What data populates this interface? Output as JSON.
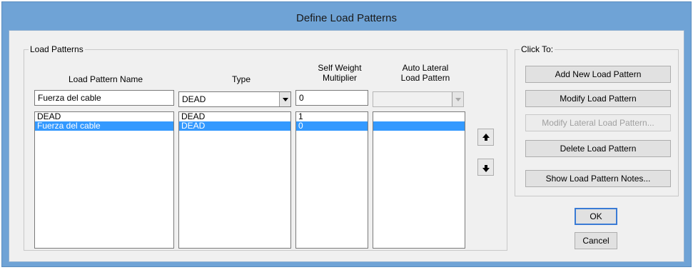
{
  "window": {
    "title": "Define Load Patterns"
  },
  "load_patterns": {
    "group_label": "Load Patterns",
    "headers": {
      "name": "Load Pattern Name",
      "type": "Type",
      "self_weight": [
        "Self Weight",
        "Multiplier"
      ],
      "auto_lateral": [
        "Auto Lateral",
        "Load Pattern"
      ]
    },
    "edit_row": {
      "name": "Fuerza del cable",
      "type": "DEAD",
      "self_weight": "0",
      "auto_lateral": ""
    },
    "rows": [
      {
        "name": "DEAD",
        "type": "DEAD",
        "self_weight": "1",
        "auto_lateral": "",
        "selected": false
      },
      {
        "name": "Fuerza del cable",
        "type": "DEAD",
        "self_weight": "0",
        "auto_lateral": "",
        "selected": true
      }
    ],
    "icons": {
      "move_up": "arrow-up-icon",
      "move_down": "arrow-down-icon",
      "dropdown": "chevron-down-icon"
    }
  },
  "click_to": {
    "group_label": "Click To:",
    "buttons": {
      "add": "Add New Load Pattern",
      "modify": "Modify Load Pattern",
      "modify_lateral": "Modify Lateral Load Pattern...",
      "delete": "Delete Load Pattern",
      "notes": "Show Load Pattern Notes..."
    }
  },
  "actions": {
    "ok": "OK",
    "cancel": "Cancel"
  },
  "colors": {
    "title_bar": "#6fa3d6",
    "selection": "#3399ff",
    "dialog_bg": "#f0f0f0"
  }
}
